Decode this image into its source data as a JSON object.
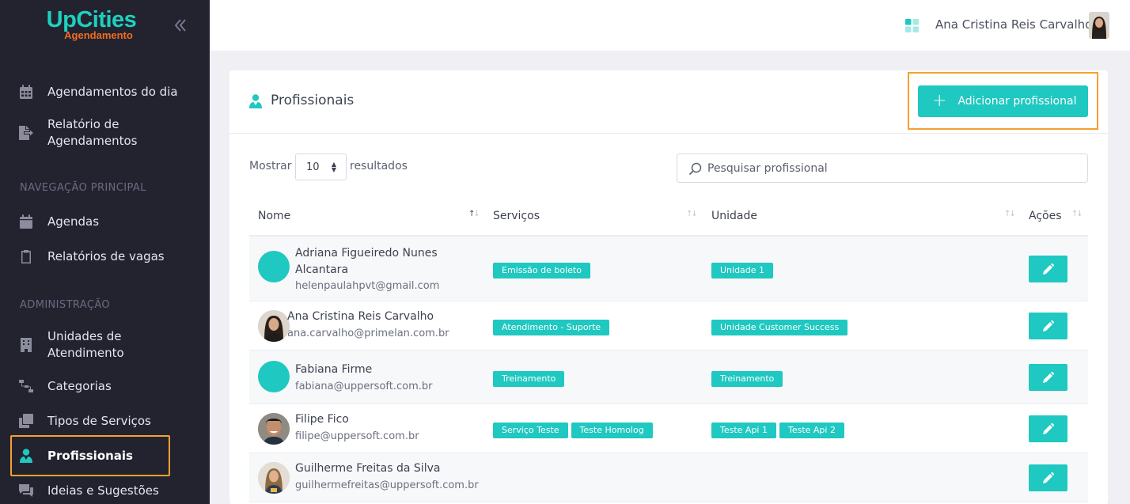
{
  "brand": {
    "name": "UpCities",
    "subtitle": "Agendamento"
  },
  "topbar": {
    "user_name": "Ana Cristina Reis Carvalho"
  },
  "sidebar": {
    "items_top": [
      {
        "label": "Agendamentos do dia",
        "icon": "calendar-icon"
      },
      {
        "label": "Relatório de Agendamentos",
        "icon": "file-export-icon"
      }
    ],
    "section_main": "NAVEGAÇÃO PRINCIPAL",
    "items_main": [
      {
        "label": "Agendas",
        "icon": "calendar-icon"
      },
      {
        "label": "Relatórios de vagas",
        "icon": "clipboard-icon"
      }
    ],
    "section_admin": "ADMINISTRAÇÃO",
    "items_admin": [
      {
        "label": "Unidades de Atendimento",
        "icon": "building-icon"
      },
      {
        "label": "Categorias",
        "icon": "sitemap-icon"
      },
      {
        "label": "Tipos de Serviços",
        "icon": "clone-icon"
      },
      {
        "label": "Profissionais",
        "icon": "user-tie-icon",
        "active": true
      },
      {
        "label": "Ideias e Sugestões",
        "icon": "comments-icon"
      }
    ]
  },
  "page": {
    "title": "Profissionais",
    "add_button": "Adicionar profissional",
    "show_label": "Mostrar",
    "show_value": "10",
    "results_label": "resultados",
    "search_placeholder": "Pesquisar profissional"
  },
  "table": {
    "headers": [
      "Nome",
      "Serviços",
      "Unidade",
      "Ações"
    ],
    "rows": [
      {
        "name": "Adriana Figueiredo Nunes Alcantara",
        "email": "helenpaulahpvt@gmail.com",
        "services": [
          "Emissão de boleto"
        ],
        "units": [
          "Unidade 1"
        ]
      },
      {
        "name": "Ana Cristina Reis Carvalho",
        "email": "ana.carvalho@primelan.com.br",
        "services": [
          "Atendimento - Suporte"
        ],
        "units": [
          "Unidade Customer Success"
        ]
      },
      {
        "name": "Fabiana Firme",
        "email": "fabiana@uppersoft.com.br",
        "services": [
          "Treinamento"
        ],
        "units": [
          "Treinamento"
        ]
      },
      {
        "name": "Filipe Fico",
        "email": "filipe@uppersoft.com.br",
        "services": [
          "Serviço Teste",
          "Teste Homolog"
        ],
        "units": [
          "Teste Api 1",
          "Teste Api 2"
        ]
      },
      {
        "name": "Guilherme Freitas da Silva",
        "email": "guilhermefreitas@uppersoft.com.br",
        "services": [],
        "units": []
      }
    ]
  },
  "colors": {
    "accent": "#1fc8c0",
    "sidebar_bg": "#232330",
    "highlight": "#f5a030",
    "logo_orange": "#f26b21"
  }
}
